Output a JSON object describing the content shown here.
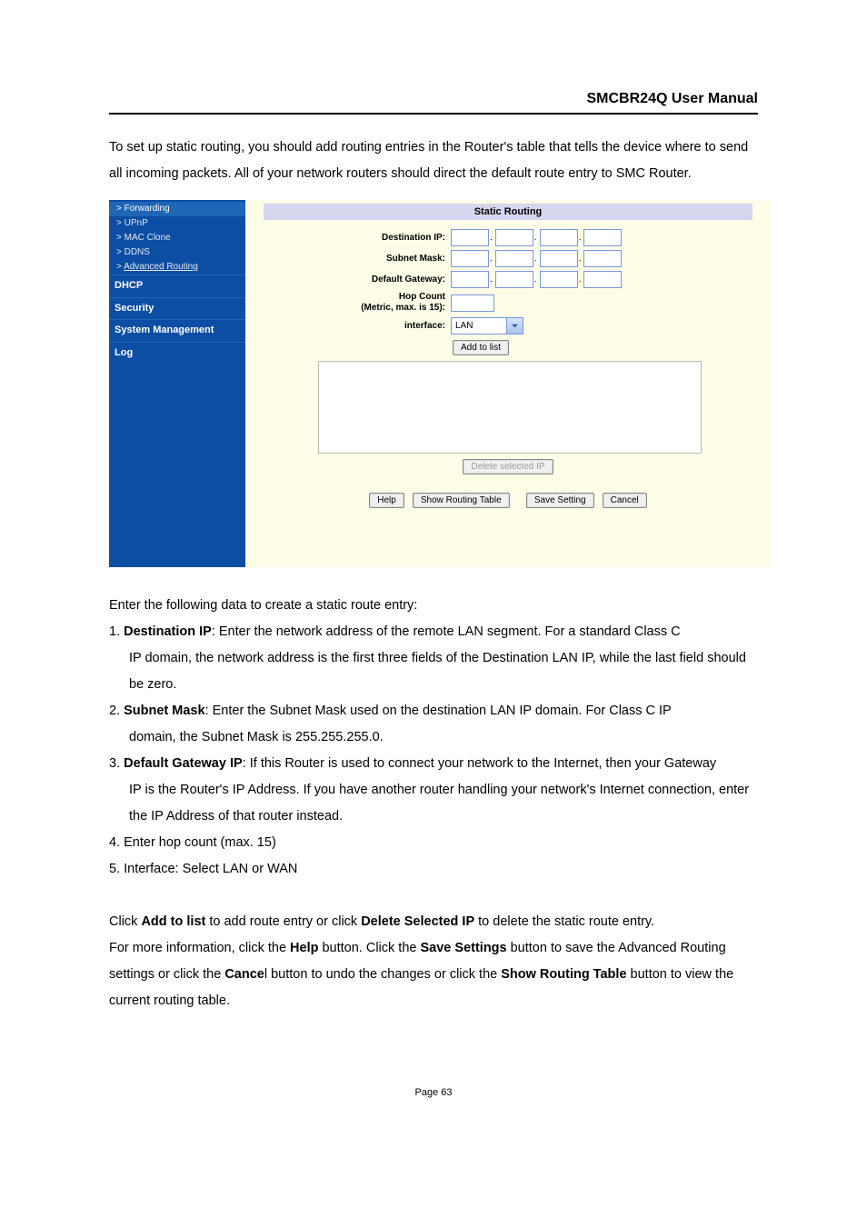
{
  "header": {
    "title": "SMCBR24Q User Manual"
  },
  "intro": "To set up static routing, you should add routing entries in the Router's table that tells the device where to send all incoming packets. All of your network routers should direct the default route entry to SMC Router.",
  "sidebar": {
    "forwarding": "> Forwarding",
    "upnp": "> UPnP",
    "macclone": "> MAC Clone",
    "ddns": "> DDNS",
    "advrouting": "Advanced Routing",
    "dhcp": "DHCP",
    "security": "Security",
    "sysm": "System Management",
    "log": "Log"
  },
  "panel": {
    "title": "Static Routing",
    "labels": {
      "dest": "Destination IP:",
      "mask": "Subnet Mask:",
      "gateway": "Default Gateway:",
      "hop1": "Hop Count",
      "hop2": "(Metric, max. is 15):",
      "iface": "interface:"
    },
    "interface_value": "LAN",
    "buttons": {
      "add": "Add to list",
      "del": "Delete selected IP",
      "help": "Help",
      "show": "Show Routing Table",
      "save": "Save Setting",
      "cancel": "Cancel"
    }
  },
  "instr_lead": "Enter the following data to create a static route entry:",
  "instr": {
    "i1a": "Destination IP",
    "i1b": ": Enter the network address of the remote LAN segment. For a standard Class C",
    "i1c": "IP domain, the network address is the first three fields of the Destination LAN IP, while the last field should be zero.",
    "i2a": "Subnet Mask",
    "i2b": ": Enter the Subnet Mask used on the destination LAN IP domain. For Class C IP",
    "i2c": "domain, the Subnet Mask is 255.255.255.0.",
    "i3a": "Default Gateway IP",
    "i3b": ": If this Router is used to connect your network to the Internet, then your Gateway",
    "i3c": "IP is the Router's IP Address. If you have another router handling your network's Internet connection, enter the IP Address of that router instead.",
    "i4": "Enter hop count (max. 15)",
    "i5": "Interface: Select LAN or WAN"
  },
  "para2": {
    "t1": "Click ",
    "b1": "Add to list",
    "t2": " to add route entry or click ",
    "b2": "Delete Selected IP",
    "t3": " to delete the static route entry."
  },
  "para3": {
    "t1": "For more information, click the ",
    "b1": "Help",
    "t2": " button. Click the ",
    "b2": "Save Settings",
    "t3": " button to save the Advanced Routing settings or click the ",
    "b3": "Cance",
    "t4": "l button to undo the changes or click the ",
    "b4": "Show Routing Table",
    "t5": " button to view the current routing table."
  },
  "pagenum": "Page 63"
}
